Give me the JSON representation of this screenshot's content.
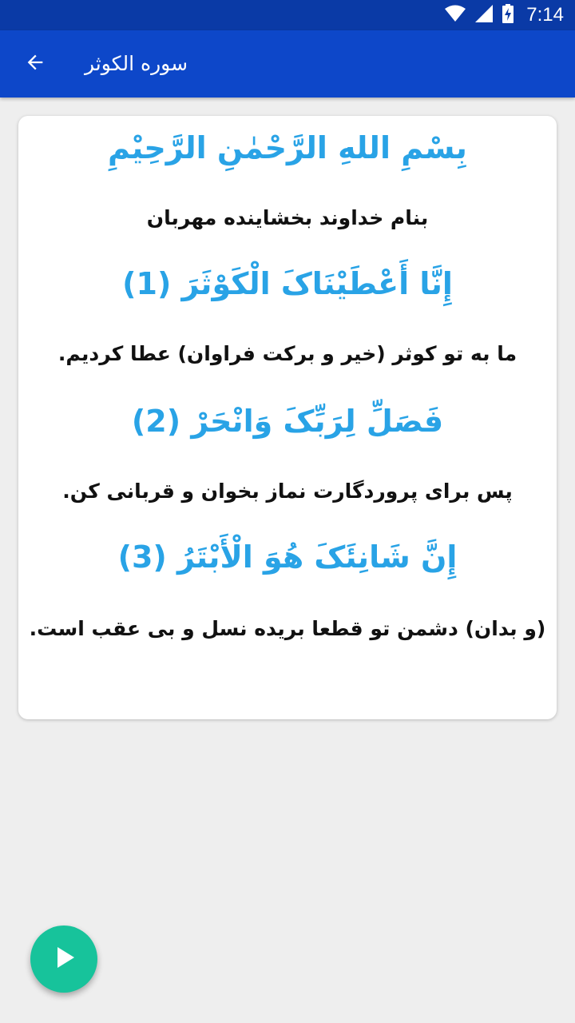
{
  "status_bar": {
    "time": "7:14",
    "icons": [
      "wifi-icon",
      "signal-icon",
      "battery-charging-icon"
    ]
  },
  "app_bar": {
    "title": "سوره الکوثر",
    "back_icon": "arrow-back-icon"
  },
  "card": {
    "bismillah_arabic": "بِسْمِ اللهِ الرَّحْمٰنِ الرَّحِیْمِ",
    "bismillah_translation": "بنام خداوند بخشاینده مهربان",
    "verses": [
      {
        "arabic": "إِنَّا أَعْطَيْنَاکَ الْکَوْثَرَ (1)",
        "translation": "ما به تو کوثر (خیر و برکت فراوان) عطا کردیم."
      },
      {
        "arabic": "فَصَلِّ لِرَبِّکَ وَانْحَرْ (2)",
        "translation": "پس برای پروردگارت نماز بخوان و قربانی کن."
      },
      {
        "arabic": "إِنَّ شَانِئَکَ هُوَ الْأَبْتَرُ (3)",
        "translation": "(و بدان) دشمن تو قطعا بریده نسل و بی عقب است."
      }
    ]
  },
  "fab": {
    "icon": "play-icon"
  },
  "colors": {
    "status_bar": "#0a3aa6",
    "app_bar": "#0d47c9",
    "arabic_text": "#29a3e6",
    "fab": "#17c39b",
    "background": "#eeeeee"
  }
}
